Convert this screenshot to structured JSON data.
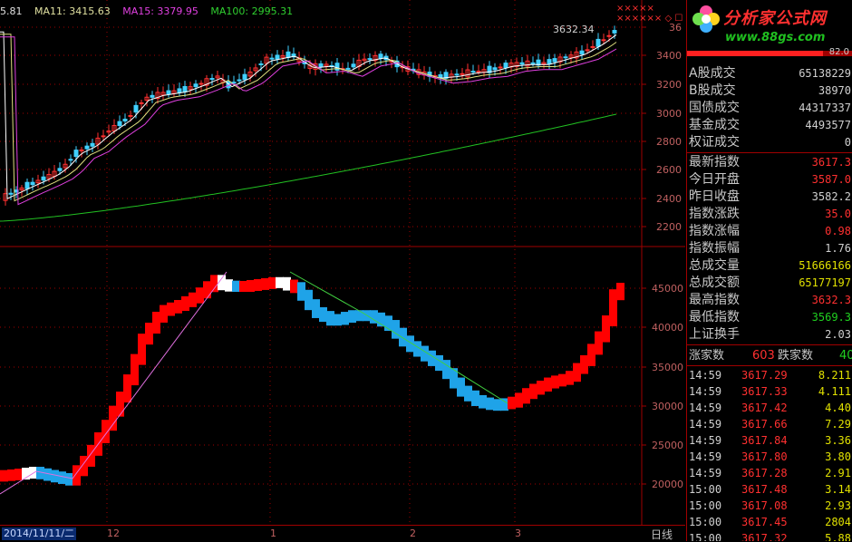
{
  "legend": {
    "ma5": "5.81",
    "ma11": "MA11: 3415.63",
    "ma15": "MA15: 3379.95",
    "ma100": "MA100: 2995.31"
  },
  "peak_label": "3632.34",
  "top_icons": "×××××  ×××××× ◇ ☐",
  "upper_axis": [
    "36",
    "3400",
    "3200",
    "3000",
    "2800",
    "2600",
    "2400",
    "2200"
  ],
  "lower_axis": [
    "45000",
    "40000",
    "35000",
    "30000",
    "25000",
    "20000"
  ],
  "x_axis": {
    "date": "2014/11/11/二",
    "months": [
      "12",
      "1",
      "2",
      "3"
    ],
    "period": "日线"
  },
  "colors": {
    "up": "#ff0000",
    "down": "#1fa3e8",
    "ma100": "#22c022",
    "grid": "#a00000"
  },
  "logo": {
    "title": "分析家公式网",
    "url": "www.88gs.com"
  },
  "progress": {
    "label": "82.0",
    "fraction": 0.82
  },
  "stats": [
    {
      "label": "A股成交",
      "value": "65138229",
      "color": "#d0d0d0"
    },
    {
      "label": "B股成交",
      "value": "38970",
      "color": "#d0d0d0"
    },
    {
      "label": "国债成交",
      "value": "44317337",
      "color": "#d0d0d0"
    },
    {
      "label": "基金成交",
      "value": "4493577",
      "color": "#d0d0d0"
    },
    {
      "label": "权证成交",
      "value": "0",
      "color": "#d0d0d0"
    }
  ],
  "index": [
    {
      "label": "最新指数",
      "value": "3617.3",
      "color": "#ff3030"
    },
    {
      "label": "今日开盘",
      "value": "3587.0",
      "color": "#ff3030"
    },
    {
      "label": "昨日收盘",
      "value": "3582.2",
      "color": "#d0d0d0"
    },
    {
      "label": "指数涨跌",
      "value": "35.0",
      "color": "#ff3030"
    },
    {
      "label": "指数涨幅",
      "value": "0.98",
      "color": "#ff3030"
    },
    {
      "label": "指数振幅",
      "value": "1.76",
      "color": "#d0d0d0"
    },
    {
      "label": "总成交量",
      "value": "51666166",
      "color": "#e0e000"
    },
    {
      "label": "总成交额",
      "value": "65177197",
      "color": "#e0e000"
    },
    {
      "label": "最高指数",
      "value": "3632.3",
      "color": "#ff3030"
    },
    {
      "label": "最低指数",
      "value": "3569.3",
      "color": "#20d020"
    },
    {
      "label": "上证换手",
      "value": "2.03",
      "color": "#d0d0d0"
    }
  ],
  "updown": {
    "up_label": "涨家数",
    "up_value": "603",
    "down_label": "跌家数",
    "down_value": "40"
  },
  "ticks": [
    {
      "time": "14:59",
      "price": "3617.29",
      "vol": "8.211"
    },
    {
      "time": "14:59",
      "price": "3617.33",
      "vol": "4.111"
    },
    {
      "time": "14:59",
      "price": "3617.42",
      "vol": "4.40"
    },
    {
      "time": "14:59",
      "price": "3617.66",
      "vol": "7.29"
    },
    {
      "time": "14:59",
      "price": "3617.84",
      "vol": "3.36"
    },
    {
      "time": "14:59",
      "price": "3617.80",
      "vol": "3.80"
    },
    {
      "time": "14:59",
      "price": "3617.28",
      "vol": "2.91"
    },
    {
      "time": "15:00",
      "price": "3617.48",
      "vol": "3.14"
    },
    {
      "time": "15:00",
      "price": "3617.08",
      "vol": "2.93"
    },
    {
      "time": "15:00",
      "price": "3617.45",
      "vol": "2804"
    },
    {
      "time": "15:00",
      "price": "3617.32",
      "vol": "5.88"
    }
  ]
}
